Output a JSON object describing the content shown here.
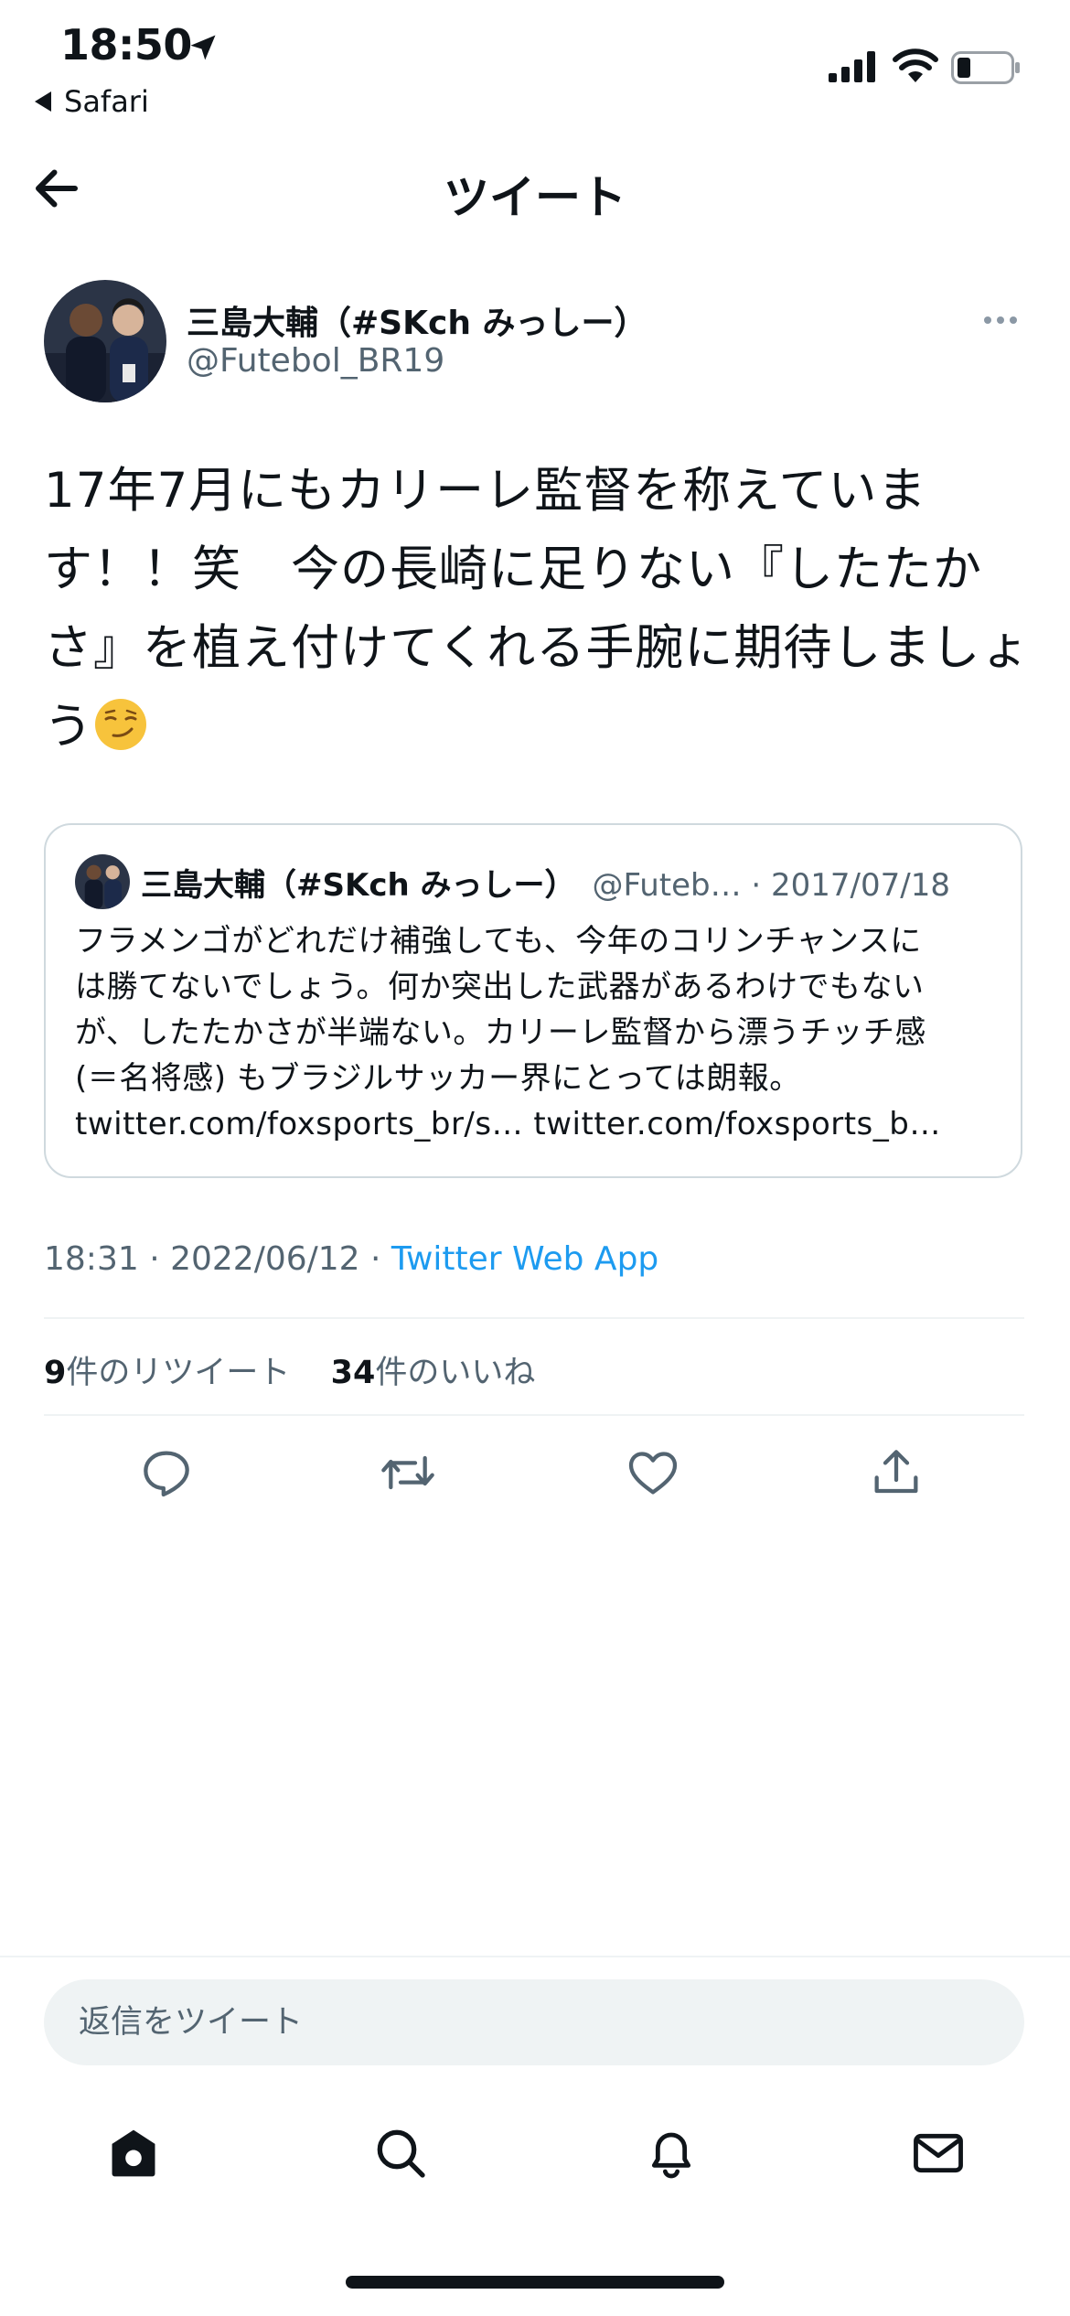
{
  "status_bar": {
    "time": "18:50",
    "back_app": "Safari",
    "icons": [
      "location-arrow-icon",
      "cellular-signal-icon",
      "wifi-icon",
      "battery-icon"
    ]
  },
  "header": {
    "title": "ツイート",
    "back_icon": "arrow-left-icon"
  },
  "tweet": {
    "author_name": "三島大輔（#SKch みっしー）",
    "author_handle": "@Futebol_BR19",
    "text": "17年7月にもカリーレ監督を称えています！！笑　今の長崎に足りない『したたかさ』を植え付けてくれる手腕に期待しましょう",
    "emoji": "smirking-face-emoji",
    "quote": {
      "author_name": "三島大輔（#SKch みっしー）",
      "meta": "@Futeb… · 2017/07/18",
      "lines": [
        "フラメンゴがどれだけ補強しても、今年のコリンチャンスに",
        "は勝てないでしょう。何か突出した武器があるわけでもない",
        "が、したたかさが半端ない。カリーレ監督から漂うチッチ感",
        "(＝名将感) もブラジルサッカー界にとっては朗報。",
        "twitter.com/foxsports_br/s… twitter.com/foxsports_b…"
      ]
    },
    "timestamp": "18:31 · 2022/06/12 · ",
    "source": "Twitter Web App",
    "retweet_count": "9",
    "retweet_label": "件のリツイート",
    "like_count": "34",
    "like_label": "件のいいね"
  },
  "actions": [
    "reply-icon",
    "retweet-icon",
    "like-icon",
    "share-icon"
  ],
  "reply": {
    "placeholder": "返信をツイート"
  },
  "tabbar": [
    "home-icon",
    "search-icon",
    "notifications-icon",
    "messages-icon"
  ],
  "colors": {
    "text": "#0f1419",
    "secondary": "#536471",
    "link": "#1d9bf0",
    "border": "#cfd9de",
    "divider": "#eff3f4"
  }
}
